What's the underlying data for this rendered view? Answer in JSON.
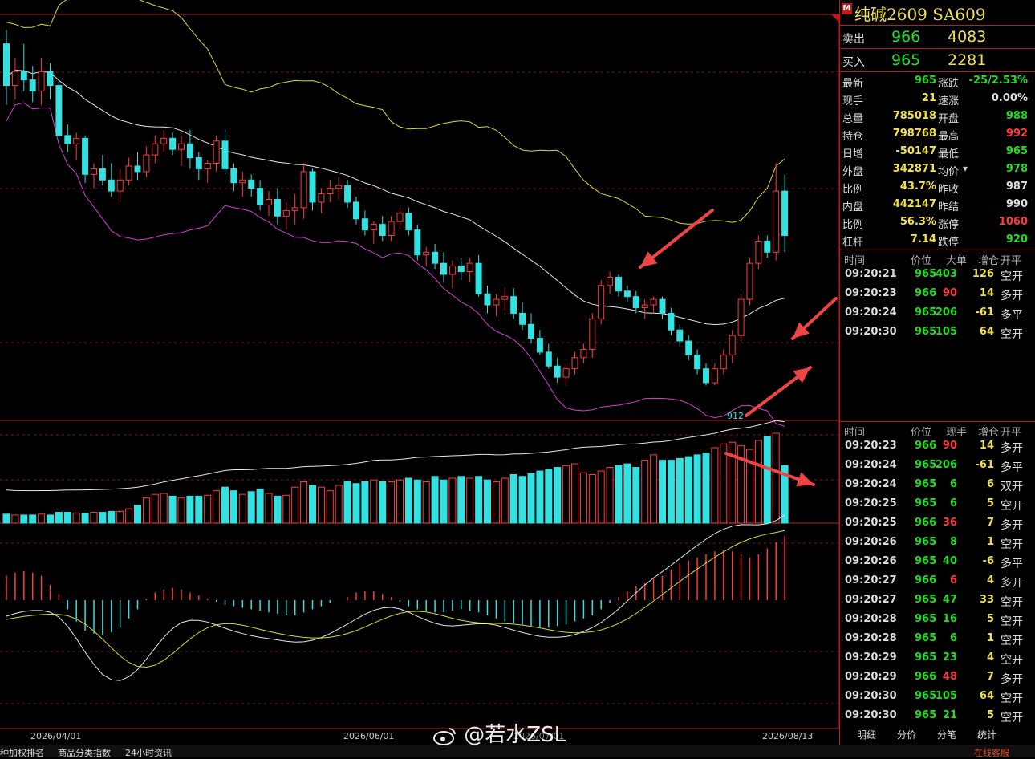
{
  "chart_data": {
    "type": "candlestick",
    "x_labels": [
      "2026/04/01",
      "2026/06/01",
      "2026/08/13"
    ],
    "overlay_labels": [
      "2026/07/01"
    ],
    "low_label": "912",
    "ohlc": [
      [
        1035,
        1040,
        1013,
        1020
      ],
      [
        1020,
        1030,
        1015,
        1025
      ],
      [
        1025,
        1035,
        1018,
        1022
      ],
      [
        1022,
        1027,
        1014,
        1018
      ],
      [
        1018,
        1030,
        1013,
        1025
      ],
      [
        1025,
        1028,
        1015,
        1020
      ],
      [
        1020,
        1022,
        1000,
        1002
      ],
      [
        1002,
        1006,
        996,
        999
      ],
      [
        999,
        1003,
        993,
        1001
      ],
      [
        1001,
        1002,
        985,
        988
      ],
      [
        988,
        992,
        983,
        990
      ],
      [
        990,
        995,
        984,
        986
      ],
      [
        986,
        992,
        980,
        982
      ],
      [
        982,
        990,
        978,
        986
      ],
      [
        986,
        994,
        984,
        991
      ],
      [
        991,
        996,
        986,
        989
      ],
      [
        989,
        998,
        987,
        995
      ],
      [
        995,
        1002,
        992,
        999
      ],
      [
        999,
        1004,
        996,
        1001
      ],
      [
        1001,
        1003,
        995,
        997
      ],
      [
        997,
        1002,
        991,
        999
      ],
      [
        999,
        1004,
        990,
        994
      ],
      [
        994,
        996,
        986,
        990
      ],
      [
        990,
        993,
        985,
        992
      ],
      [
        992,
        1002,
        989,
        1000
      ],
      [
        1000,
        1004,
        988,
        990
      ],
      [
        990,
        992,
        982,
        985
      ],
      [
        985,
        989,
        980,
        986
      ],
      [
        986,
        988,
        980,
        983
      ],
      [
        983,
        986,
        975,
        977
      ],
      [
        977,
        982,
        973,
        979
      ],
      [
        979,
        983,
        970,
        973
      ],
      [
        973,
        978,
        968,
        975
      ],
      [
        975,
        981,
        970,
        976
      ],
      [
        976,
        992,
        972,
        989
      ],
      [
        989,
        990,
        975,
        978
      ],
      [
        978,
        983,
        974,
        981
      ],
      [
        981,
        986,
        978,
        983
      ],
      [
        983,
        987,
        979,
        984
      ],
      [
        984,
        986,
        976,
        978
      ],
      [
        978,
        980,
        970,
        972
      ],
      [
        972,
        975,
        966,
        968
      ],
      [
        968,
        971,
        963,
        970
      ],
      [
        970,
        973,
        964,
        966
      ],
      [
        966,
        973,
        964,
        971
      ],
      [
        971,
        976,
        968,
        974
      ],
      [
        974,
        976,
        966,
        968
      ],
      [
        968,
        970,
        957,
        959
      ],
      [
        959,
        962,
        955,
        960
      ],
      [
        960,
        963,
        954,
        956
      ],
      [
        956,
        960,
        949,
        952
      ],
      [
        952,
        957,
        947,
        955
      ],
      [
        955,
        958,
        950,
        953
      ],
      [
        953,
        958,
        949,
        956
      ],
      [
        956,
        959,
        944,
        945
      ],
      [
        945,
        948,
        938,
        941
      ],
      [
        941,
        945,
        937,
        943
      ],
      [
        943,
        947,
        939,
        944
      ],
      [
        944,
        947,
        936,
        938
      ],
      [
        938,
        942,
        932,
        934
      ],
      [
        934,
        938,
        927,
        929
      ],
      [
        929,
        932,
        923,
        924
      ],
      [
        924,
        927,
        918,
        919
      ],
      [
        919,
        922,
        913,
        915
      ],
      [
        915,
        920,
        912,
        918
      ],
      [
        918,
        924,
        916,
        922
      ],
      [
        922,
        927,
        920,
        925
      ],
      [
        925,
        938,
        922,
        936
      ],
      [
        936,
        950,
        934,
        948
      ],
      [
        948,
        953,
        945,
        951
      ],
      [
        951,
        952,
        944,
        946
      ],
      [
        946,
        948,
        942,
        944
      ],
      [
        944,
        946,
        938,
        940
      ],
      [
        940,
        943,
        936,
        941
      ],
      [
        941,
        944,
        938,
        943
      ],
      [
        943,
        944,
        936,
        938
      ],
      [
        938,
        940,
        930,
        932
      ],
      [
        932,
        934,
        926,
        928
      ],
      [
        928,
        930,
        921,
        923
      ],
      [
        923,
        925,
        916,
        918
      ],
      [
        918,
        920,
        912,
        913
      ],
      [
        913,
        920,
        912,
        918
      ],
      [
        918,
        925,
        916,
        923
      ],
      [
        923,
        932,
        920,
        930
      ],
      [
        930,
        945,
        928,
        943
      ],
      [
        943,
        958,
        941,
        956
      ],
      [
        956,
        966,
        954,
        964
      ],
      [
        964,
        966,
        958,
        960
      ],
      [
        960,
        992,
        957,
        982
      ],
      [
        982,
        988,
        960,
        966
      ]
    ],
    "volume_scale_max": 100,
    "volume": [
      10,
      9,
      9,
      9,
      10,
      9,
      12,
      12,
      11,
      11,
      12,
      12,
      13,
      13,
      16,
      20,
      28,
      32,
      33,
      30,
      28,
      30,
      30,
      31,
      36,
      40,
      36,
      32,
      35,
      38,
      33,
      30,
      31,
      40,
      46,
      42,
      40,
      36,
      42,
      46,
      44,
      46,
      48,
      46,
      46,
      48,
      50,
      48,
      46,
      52,
      48,
      50,
      52,
      50,
      52,
      48,
      46,
      50,
      54,
      52,
      55,
      58,
      60,
      62,
      64,
      66,
      56,
      54,
      58,
      62,
      64,
      66,
      62,
      70,
      76,
      70,
      70,
      72,
      74,
      76,
      78,
      84,
      88,
      90,
      86,
      82,
      92,
      96,
      100,
      64
    ],
    "macd": [
      0.8,
      0.9,
      0.95,
      0.9,
      0.8,
      0.5,
      0.2,
      -0.3,
      -0.7,
      -1.0,
      -1.1,
      -1.15,
      -1.05,
      -0.9,
      -0.6,
      -0.3,
      0.05,
      0.25,
      0.35,
      0.4,
      0.35,
      0.25,
      0.15,
      0.05,
      -0.05,
      -0.15,
      -0.2,
      -0.25,
      -0.3,
      -0.35,
      -0.4,
      -0.45,
      -0.5,
      -0.5,
      -0.4,
      -0.3,
      -0.2,
      -0.1,
      0,
      0.1,
      0.25,
      0.3,
      0.3,
      0.2,
      0.1,
      -0.05,
      -0.2,
      -0.3,
      -0.35,
      -0.4,
      -0.4,
      -0.35,
      -0.3,
      -0.35,
      -0.4,
      -0.5,
      -0.6,
      -0.7,
      -0.75,
      -0.8,
      -0.85,
      -0.9,
      -0.9,
      -0.85,
      -0.8,
      -0.7,
      -0.6,
      -0.5,
      -0.3,
      -0.1,
      0.1,
      0.3,
      0.45,
      0.55,
      0.7,
      0.8,
      1.0,
      1.2,
      1.3,
      1.4,
      1.5,
      1.6,
      1.65,
      1.6,
      1.5,
      1.4,
      1.5,
      1.7,
      1.9,
      2.1
    ]
  },
  "title": {
    "badge": "M",
    "text": "纯碱2609  SA609"
  },
  "quote": {
    "ask": {
      "label": "卖出",
      "price": "966",
      "vol": "4083"
    },
    "bid": {
      "label": "买入",
      "price": "965",
      "vol": "2281"
    }
  },
  "stats": [
    {
      "l1": "最新",
      "v1": "965",
      "c1": "g",
      "l2": "涨跌",
      "v2": "-25/2.53%",
      "c2": "g"
    },
    {
      "l1": "现手",
      "v1": "21",
      "c1": "y",
      "l2": "速涨",
      "v2": "0.00%",
      "c2": "w"
    },
    {
      "l1": "总量",
      "v1": "785018",
      "c1": "y",
      "l2": "开盘",
      "v2": "988",
      "c2": "g"
    },
    {
      "l1": "持仓",
      "v1": "798768",
      "c1": "y",
      "l2": "最高",
      "v2": "992",
      "c2": "r"
    },
    {
      "l1": "日增",
      "v1": "-50147",
      "c1": "y",
      "l2": "最低",
      "v2": "965",
      "c2": "g"
    },
    {
      "l1": "外盘",
      "v1": "342871",
      "c1": "y",
      "l2": "均价",
      "v2": "978",
      "c2": "g"
    },
    {
      "l1": "比例",
      "v1": "43.7%",
      "c1": "y",
      "l2": "昨收",
      "v2": "987",
      "c2": "w"
    },
    {
      "l1": "内盘",
      "v1": "442147",
      "c1": "y",
      "l2": "昨结",
      "v2": "990",
      "c2": "w"
    },
    {
      "l1": "比例",
      "v1": "56.3%",
      "c1": "y",
      "l2": "涨停",
      "v2": "1060",
      "c2": "r"
    },
    {
      "l1": "杠杆",
      "v1": "7.14",
      "c1": "y",
      "l2": "跌停",
      "v2": "920",
      "c2": "g"
    }
  ],
  "trades1": {
    "headers": [
      "时间",
      "价位",
      "大单",
      "增仓",
      "开平"
    ],
    "rows": [
      {
        "time": "09:20:21",
        "price": "965",
        "pc": "g",
        "vol": "403",
        "vc": "g",
        "oi": "126",
        "type": "空开"
      },
      {
        "time": "09:20:23",
        "price": "966",
        "pc": "g",
        "vol": "90",
        "vc": "r",
        "oi": "14",
        "type": "多开"
      },
      {
        "time": "09:20:24",
        "price": "965",
        "pc": "g",
        "vol": "206",
        "vc": "g",
        "oi": "-61",
        "type": "多平"
      },
      {
        "time": "09:20:30",
        "price": "965",
        "pc": "g",
        "vol": "105",
        "vc": "g",
        "oi": "64",
        "type": "空开"
      }
    ]
  },
  "trades2": {
    "headers": [
      "时间",
      "价位",
      "现手",
      "增仓",
      "开平"
    ],
    "rows": [
      {
        "time": "09:20:23",
        "price": "966",
        "pc": "g",
        "vol": "90",
        "vc": "r",
        "oi": "14",
        "type": "多开"
      },
      {
        "time": "09:20:24",
        "price": "965",
        "pc": "g",
        "vol": "206",
        "vc": "g",
        "oi": "-61",
        "type": "多平"
      },
      {
        "time": "09:20:24",
        "price": "965",
        "pc": "g",
        "vol": "6",
        "vc": "g",
        "oi": "6",
        "type": "双开"
      },
      {
        "time": "09:20:25",
        "price": "965",
        "pc": "g",
        "vol": "6",
        "vc": "g",
        "oi": "5",
        "type": "空开"
      },
      {
        "time": "09:20:25",
        "price": "966",
        "pc": "g",
        "vol": "36",
        "vc": "r",
        "oi": "7",
        "type": "多开"
      },
      {
        "time": "09:20:26",
        "price": "965",
        "pc": "g",
        "vol": "8",
        "vc": "g",
        "oi": "1",
        "type": "空开"
      },
      {
        "time": "09:20:26",
        "price": "965",
        "pc": "g",
        "vol": "40",
        "vc": "g",
        "oi": "-6",
        "type": "多平"
      },
      {
        "time": "09:20:27",
        "price": "966",
        "pc": "g",
        "vol": "6",
        "vc": "r",
        "oi": "4",
        "type": "多开"
      },
      {
        "time": "09:20:27",
        "price": "965",
        "pc": "g",
        "vol": "47",
        "vc": "g",
        "oi": "33",
        "type": "空开"
      },
      {
        "time": "09:20:28",
        "price": "965",
        "pc": "g",
        "vol": "16",
        "vc": "g",
        "oi": "5",
        "type": "空开"
      },
      {
        "time": "09:20:28",
        "price": "965",
        "pc": "g",
        "vol": "6",
        "vc": "g",
        "oi": "1",
        "type": "空开"
      },
      {
        "time": "09:20:29",
        "price": "965",
        "pc": "g",
        "vol": "23",
        "vc": "g",
        "oi": "4",
        "type": "空开"
      },
      {
        "time": "09:20:29",
        "price": "966",
        "pc": "g",
        "vol": "48",
        "vc": "r",
        "oi": "7",
        "type": "多开"
      },
      {
        "time": "09:20:30",
        "price": "965",
        "pc": "g",
        "vol": "105",
        "vc": "g",
        "oi": "64",
        "type": "空开"
      },
      {
        "time": "09:20:30",
        "price": "965",
        "pc": "g",
        "vol": "21",
        "vc": "g",
        "oi": "5",
        "type": "空开"
      }
    ]
  },
  "tabs": [
    "明细",
    "分价",
    "分笔",
    "统计"
  ],
  "bottom": {
    "left": [
      "种加权排名",
      "商品分类指数",
      "24小时资讯"
    ],
    "right": "在线客服"
  },
  "watermark": "@若水ZSL",
  "colors": {
    "up": "#ff3a3a",
    "down": "#34e0e0",
    "mid": "#e6e6e6",
    "upper": "#d8d830",
    "lower": "#d040d0",
    "arrow": "#ee4444"
  }
}
